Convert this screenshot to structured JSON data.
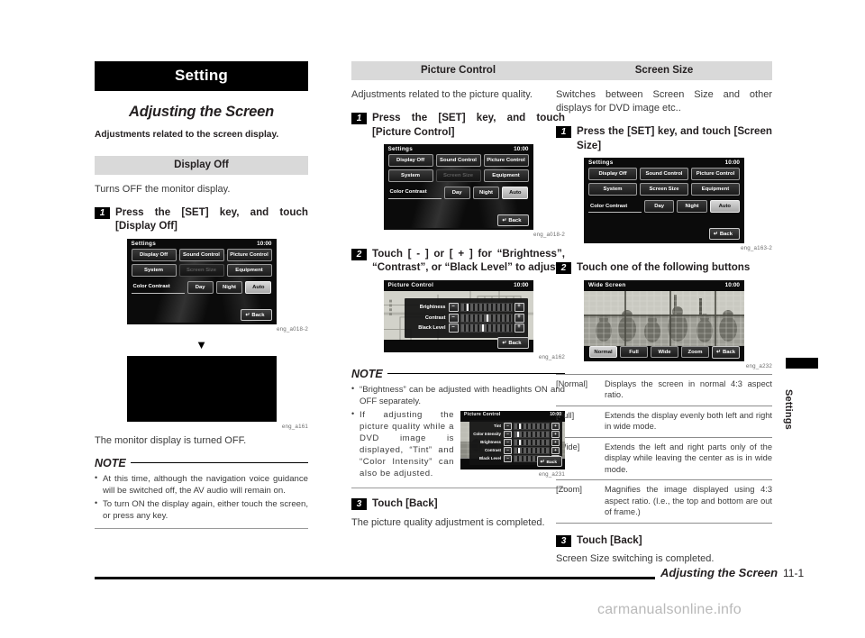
{
  "page": {
    "chapter_title": "Setting",
    "section_title": "Adjusting the Screen",
    "section_lead": "Adjustments related to the screen display.",
    "footer_title": "Adjusting the Screen",
    "footer_page": "11-1",
    "side_tab_label": "Settings",
    "watermark": "carmanualsonline.info"
  },
  "col1": {
    "heading": "Display Off",
    "intro": "Turns OFF the monitor display.",
    "step1_num": "1",
    "step1_text": "Press the [SET] key, and touch [Display Off]",
    "caption1": "eng_a018-2",
    "caption2": "eng_a161",
    "result": "The monitor display is turned OFF.",
    "note_label": "NOTE",
    "notes": [
      "At this time, although the navigation voice guidance will be switched off, the AV audio will remain on.",
      "To turn ON the display again, either touch the screen, or press any key."
    ]
  },
  "col2": {
    "heading": "Picture Control",
    "intro": "Adjustments related to the picture quality.",
    "step1_num": "1",
    "step1_text": "Press the [SET] key, and touch [Picture Control]",
    "caption1": "eng_a018-2",
    "step2_num": "2",
    "step2_text": "Touch [ - ] or [ + ] for “Brightness”, “Contrast”, or “Black Level” to adjust",
    "caption2": "eng_a162",
    "note_label": "NOTE",
    "note1": "“Brightness” can be adjusted with headlights ON and OFF separately.",
    "note2": "If adjusting the picture quality while a DVD image is displayed, “Tint” and “Color Intensity” can also be adjusted.",
    "caption3": "eng_a231",
    "step3_num": "3",
    "step3_text": "Touch [Back]",
    "step3_result": "The picture quality adjustment is completed."
  },
  "col3": {
    "heading": "Screen Size",
    "intro": "Switches between Screen Size and other displays for DVD image etc..",
    "step1_num": "1",
    "step1_text": "Press the [SET] key, and touch [Screen Size]",
    "caption1": "eng_a163-2",
    "step2_num": "2",
    "step2_text": "Touch one of the following buttons",
    "caption2": "eng_a232",
    "table": [
      {
        "key": "[Normal]",
        "val": "Displays the screen in normal 4:3 aspect ratio."
      },
      {
        "key": "[Full]",
        "val": "Extends the display evenly both left and right in wide mode."
      },
      {
        "key": "[Wide]",
        "val": "Extends the left and right parts only of the display while leaving the center as is in wide mode."
      },
      {
        "key": "[Zoom]",
        "val": "Magnifies the image displayed using 4:3 aspect ratio. (I.e., the top and bottom are out of frame.)"
      }
    ],
    "step3_num": "3",
    "step3_text": "Touch [Back]",
    "step3_result": "Screen Size switching is completed."
  },
  "device_settings_disabled": {
    "title": "Settings",
    "clock": "10:00",
    "buttons": [
      "Display Off",
      "Sound Control",
      "Picture Control",
      "System",
      "Screen Size",
      "Equipment"
    ],
    "disabled_button": "Screen Size",
    "color_contrast_label": "Color Contrast",
    "modes": [
      "Day",
      "Night",
      "Auto"
    ],
    "selected_mode": "Auto",
    "back_label": "Back"
  },
  "device_settings_enabled": {
    "title": "Settings",
    "clock": "10:00",
    "buttons": [
      "Display Off",
      "Sound Control",
      "Picture Control",
      "System",
      "Screen Size",
      "Equipment"
    ],
    "color_contrast_label": "Color Contrast",
    "modes": [
      "Day",
      "Night",
      "Auto"
    ],
    "selected_mode": "Auto",
    "back_label": "Back"
  },
  "device_picture_control": {
    "title": "Picture Control",
    "clock": "10:00",
    "sliders": [
      {
        "label": "Brightness",
        "position": 12
      },
      {
        "label": "Contrast",
        "position": 50
      },
      {
        "label": "Black Level",
        "position": 42
      }
    ],
    "minus": "–",
    "plus": "+",
    "back_label": "Back"
  },
  "device_picture_control_dvd": {
    "title": "Picture Control",
    "clock": "10:00",
    "sliders": [
      {
        "label": "Tint",
        "position": 12
      },
      {
        "label": "Color Intensity",
        "position": 8
      },
      {
        "label": "Brightness",
        "position": 14
      },
      {
        "label": "Contrast",
        "position": 10
      },
      {
        "label": "Black Level",
        "position": 78
      }
    ],
    "minus": "–",
    "plus": "+",
    "back_label": "Back"
  },
  "device_wide_screen": {
    "title": "Wide Screen",
    "clock": "10:00",
    "buttons": [
      "Normal",
      "Full",
      "Wide",
      "Zoom"
    ],
    "selected_button": "Normal",
    "back_label": "Back"
  }
}
